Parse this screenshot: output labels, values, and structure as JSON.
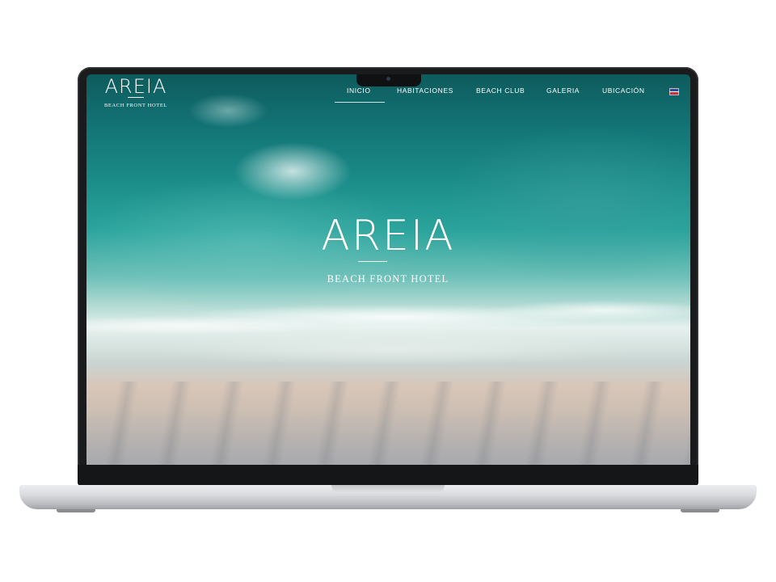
{
  "site": {
    "logo": {
      "wordmark": "AREIA",
      "tagline": "BEACH FRONT HOTEL"
    },
    "nav": [
      {
        "label": "INICIO",
        "active": true
      },
      {
        "label": "HABITACIONES",
        "active": false
      },
      {
        "label": "BEACH CLUB",
        "active": false
      },
      {
        "label": "GALERIA",
        "active": false
      },
      {
        "label": "UBICACIÓN",
        "active": false
      }
    ],
    "language_icon": "us-flag-icon",
    "hero": {
      "title": "AREIA",
      "subtitle": "BEACH FRONT HOTEL"
    }
  },
  "colors": {
    "ocean_deep": "#0e5b5c",
    "ocean_turquoise": "#2aa49c",
    "sand": "#d8c6b9",
    "laptop_bezel": "#1a1b1d",
    "laptop_base": "#d9dbde"
  }
}
